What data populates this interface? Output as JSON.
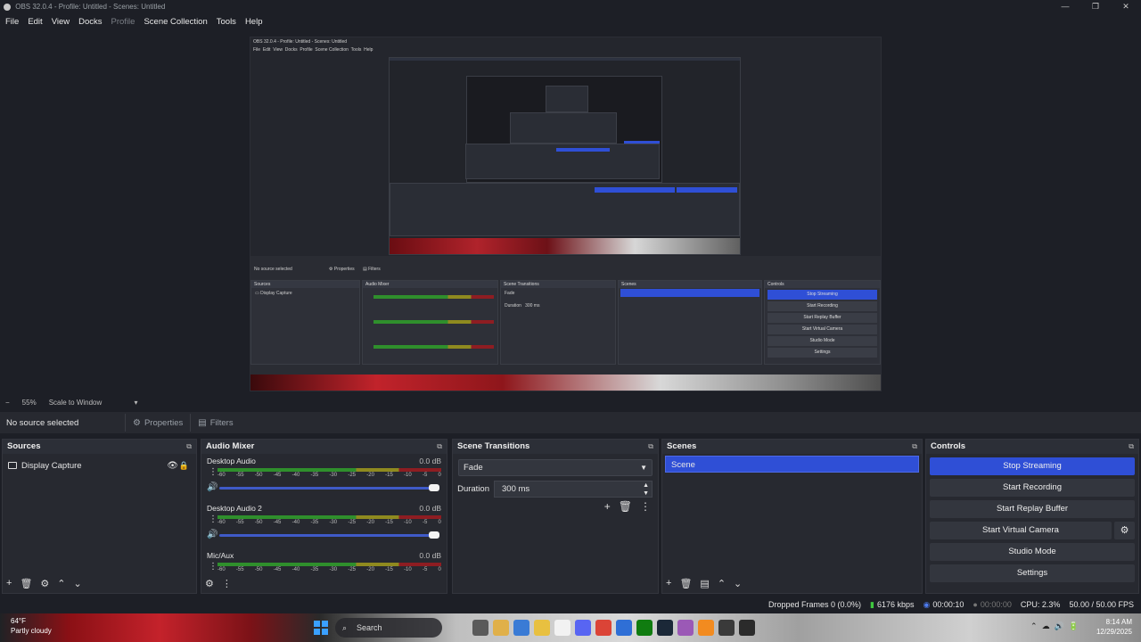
{
  "window": {
    "title": "OBS 32.0.4 - Profile: Untitled - Scenes: Untitled"
  },
  "menu": [
    "File",
    "Edit",
    "View",
    "Docks",
    "Profile",
    "Scene Collection",
    "Tools",
    "Help"
  ],
  "preview": {
    "zoom_minus": "−",
    "zoom_level": "55%",
    "scale_mode": "Scale to Window"
  },
  "props_bar": {
    "no_source": "No source selected",
    "properties": "Properties",
    "filters": "Filters"
  },
  "sources": {
    "title": "Sources",
    "items": [
      {
        "label": "Display Capture"
      }
    ]
  },
  "audio_mixer": {
    "title": "Audio Mixer",
    "channels": [
      {
        "name": "Desktop Audio",
        "db": "0.0 dB"
      },
      {
        "name": "Desktop Audio 2",
        "db": "0.0 dB"
      },
      {
        "name": "Mic/Aux",
        "db": "0.0 dB"
      }
    ],
    "scale": [
      "-60",
      "-55",
      "-50",
      "-45",
      "-40",
      "-35",
      "-30",
      "-25",
      "-20",
      "-15",
      "-10",
      "-5",
      "0"
    ]
  },
  "scene_transitions": {
    "title": "Scene Transitions",
    "transition": "Fade",
    "duration_label": "Duration",
    "duration_value": "300 ms"
  },
  "scenes": {
    "title": "Scenes",
    "items": [
      "Scene"
    ]
  },
  "controls": {
    "title": "Controls",
    "stop_streaming": "Stop Streaming",
    "start_recording": "Start Recording",
    "start_replay": "Start Replay Buffer",
    "start_virtual_cam": "Start Virtual Camera",
    "studio_mode": "Studio Mode",
    "settings": "Settings"
  },
  "status": {
    "dropped": "Dropped Frames 0 (0.0%)",
    "bitrate": "6176 kbps",
    "stream_time": "00:00:10",
    "rec_time": "00:00:00",
    "cpu": "CPU: 2.3%",
    "fps": "50.00 / 50.00 FPS"
  },
  "taskbar": {
    "temp": "64°F",
    "weather": "Partly cloudy",
    "search": "Search",
    "time": "8:14 AM",
    "date": "12/29/2025"
  },
  "colors": {
    "accent": "#2f4fd6",
    "bg": "#1d1f26",
    "panel": "#272930"
  }
}
